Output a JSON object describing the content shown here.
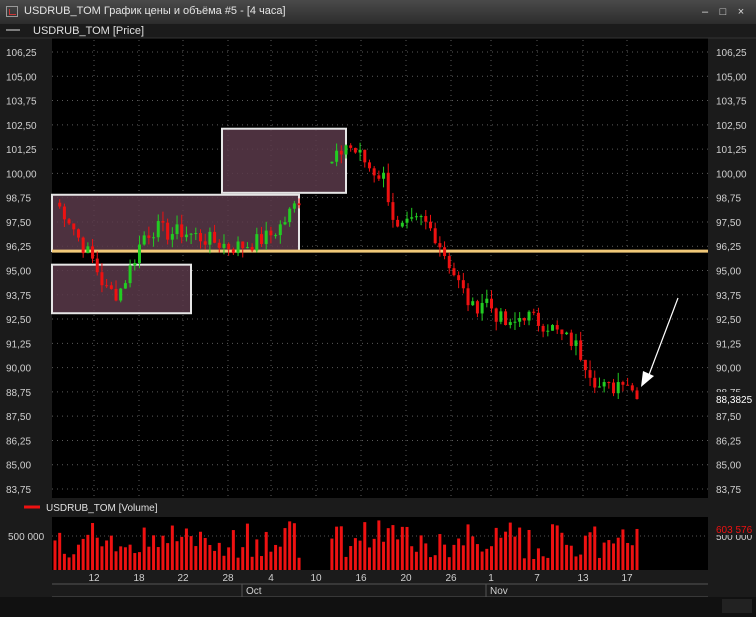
{
  "window": {
    "title": "USDRUB_TOM График цены и объёма #5 - [4 часа]",
    "icon": "chart-app-icon",
    "buttons": [
      "minimize-icon",
      "maximize-icon",
      "close-icon"
    ]
  },
  "price_panel": {
    "legend": "USDRUB_TOM [Price]",
    "last_price_label": "88,3825"
  },
  "volume_panel": {
    "legend": "USDRUB_TOM [Volume]",
    "last_volume_label": "603 576",
    "y_tick_left": "500 000",
    "y_tick_right": "500 000"
  },
  "time_axis": {
    "days": [
      "12",
      "18",
      "22",
      "28",
      "4",
      "10",
      "16",
      "20",
      "26",
      "1",
      "7",
      "13",
      "17"
    ],
    "months": [
      "Oct",
      "Nov"
    ]
  },
  "colors": {
    "up": "#22cc22",
    "down": "#ee1111",
    "level_line": "#f0c878",
    "zone_fill": "#5a3a4a",
    "zone_border": "#e6e6e6",
    "arrow": "#ffffff"
  },
  "chart_data": [
    {
      "type": "candlestick",
      "series": [
        {
          "name": "USDRUB_TOM [Price]"
        }
      ],
      "y_ticks": [
        "106,25",
        "105,00",
        "103,75",
        "102,50",
        "101,25",
        "100,00",
        "98,75",
        "97,50",
        "96,25",
        "95,00",
        "93,75",
        "92,50",
        "91,25",
        "90,00",
        "88,75",
        "87,50",
        "86,25",
        "85,00",
        "83,75"
      ],
      "ylim": [
        83.75,
        106.25
      ],
      "horizontal_line": 96.0,
      "last_value": 88.3825,
      "zones": [
        {
          "y_range": [
            99.0,
            102.3
          ]
        },
        {
          "y_range": [
            96.0,
            98.9
          ]
        },
        {
          "y_range": [
            92.8,
            95.3
          ]
        }
      ],
      "close_path": [
        98.5,
        97.8,
        96.5,
        95.5,
        94.0,
        93.8,
        95.2,
        96.8,
        97.2,
        96.9,
        97.0,
        96.8,
        96.6,
        96.4,
        96.2,
        96.3,
        96.5,
        96.8,
        97.4,
        98.4,
        99.4,
        100.2,
        100.5,
        101.5,
        101.0,
        100.2,
        99.8,
        97.0,
        97.3,
        97.6,
        96.9,
        95.6,
        94.2,
        93.0,
        93.6,
        92.6,
        92.0,
        92.8,
        92.4,
        92.2,
        91.6,
        91.3,
        90.2,
        89.0,
        88.9,
        89.6,
        88.3825
      ]
    },
    {
      "type": "bar",
      "series": [
        {
          "name": "USDRUB_TOM [Volume]"
        }
      ],
      "y_ticks": [
        "500 000"
      ],
      "last_value": 603576
    }
  ]
}
